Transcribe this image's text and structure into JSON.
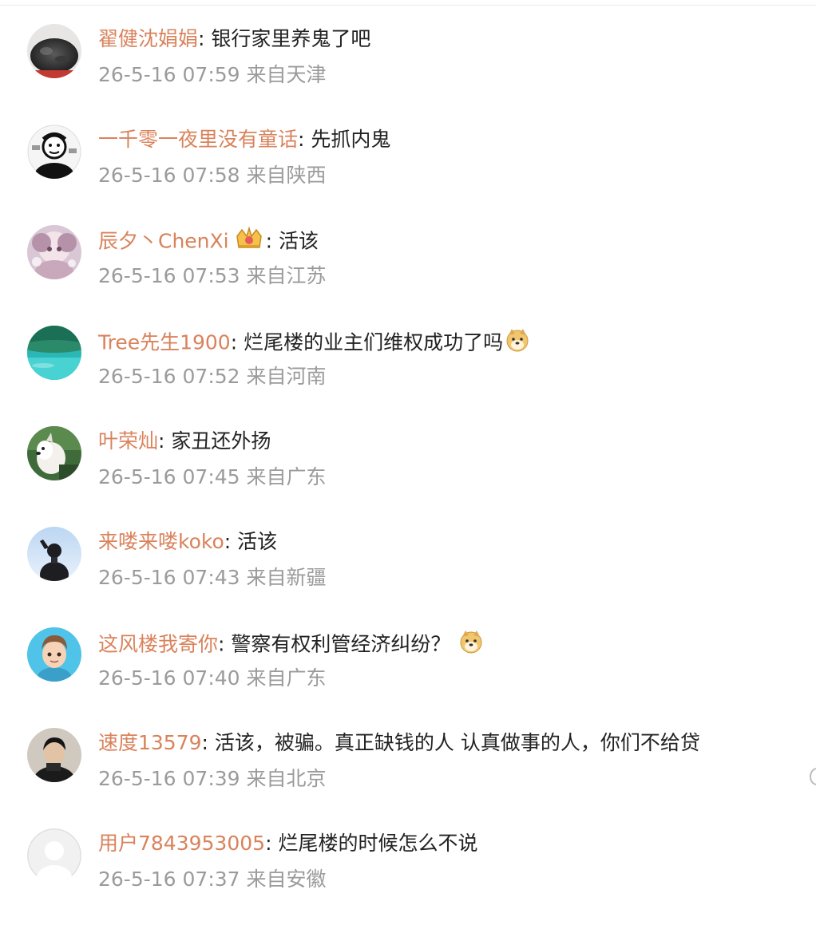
{
  "comments": [
    {
      "username": "翟健沈娟娟",
      "text": "银行家里养鬼了吧",
      "time": "26-5-16 07:59",
      "location": "来自天津",
      "avatar": "dark-rock-avatar"
    },
    {
      "username": "一千零一夜里没有童话",
      "text": "先抓内鬼",
      "time": "26-5-16 07:58",
      "location": "来自陕西",
      "avatar": "meme-avatar"
    },
    {
      "username": "辰夕丶ChenXi",
      "text": "活该",
      "time": "26-5-16 07:53",
      "location": "来自江苏",
      "avatar": "anime-girl-avatar",
      "badge": "crown-badge-icon"
    },
    {
      "username": "Tree先生1900",
      "text": "烂尾楼的业主们维权成功了吗",
      "time": "26-5-16 07:52",
      "location": "来自河南",
      "avatar": "sea-avatar",
      "emoji": "doge-emoji-icon"
    },
    {
      "username": "叶荣灿",
      "text": "家丑还外扬",
      "time": "26-5-16 07:45",
      "location": "来自广东",
      "avatar": "dog-avatar"
    },
    {
      "username": "来喽来喽koko",
      "text": "活该",
      "time": "26-5-16 07:43",
      "location": "来自新疆",
      "avatar": "person-avatar"
    },
    {
      "username": "这风楼我寄你",
      "text": "警察有权利管经济纠纷？",
      "time": "26-5-16 07:40",
      "location": "来自广东",
      "avatar": "cartoon-boy-avatar",
      "emoji": "doge-emoji-icon"
    },
    {
      "username": "速度13579",
      "text": "活该，被骗。真正缺钱的人 认真做事的人，你们不给贷",
      "time": "26-5-16 07:39",
      "location": "来自北京",
      "avatar": "man-avatar"
    },
    {
      "username": "用户7843953005",
      "text": "烂尾楼的时候怎么不说",
      "time": "26-5-16 07:37",
      "location": "来自安徽",
      "avatar": "default-avatar"
    }
  ],
  "colors": {
    "username": "#d9825b",
    "text": "#222222",
    "meta": "#9b9b9b"
  }
}
